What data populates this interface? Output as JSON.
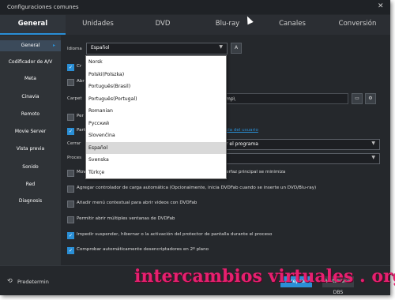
{
  "window": {
    "title": "Configuraciones comunes",
    "close": "✕"
  },
  "tabs": [
    "General",
    "Unidades",
    "DVD",
    "Blu-ray",
    "Canales",
    "Conversión"
  ],
  "sidebar": {
    "items": [
      "General",
      "Codificador de A/V",
      "Meta",
      "Cinavia",
      "Remoto",
      "Movie Server",
      "Vista previa",
      "Sonido",
      "Red",
      "Diagnosis"
    ],
    "active_arrow": "▸"
  },
  "language": {
    "label": "Idioma",
    "selected": "Español",
    "arrow": "▼",
    "font_button": "A",
    "options": [
      "Norsk",
      "Polski(Polszka)",
      "Português(Brasil)",
      "Português(Portugal)",
      "Romanian",
      "Русский",
      "Slovenčina",
      "Español",
      "Svenska",
      "Türkçe"
    ],
    "selected_index": 7
  },
  "partials": {
    "cr": "Cr",
    "abr": "Abr",
    "carpeta": "Carpet",
    "path_tail": "mp\\",
    "per": "Per",
    "part": "Part",
    "cerrar": "Cerrar",
    "procesar": "Proces",
    "mov": "Mov"
  },
  "right_texts": {
    "user_link": "cia del usuario",
    "close_program": "r el programa",
    "minimize": "erfaz principal se minimiza"
  },
  "checkboxes": [
    {
      "label": "Agregar controlador de carga automática (Opcionalmente, inicia DVDFab cuando se inserte un DVD/Blu-ray)",
      "checked": false
    },
    {
      "label": "Añadir menú contextual para abrir videos con DVDFab",
      "checked": false
    },
    {
      "label": "Permitir abrir múltiples ventanas de DVDFab",
      "checked": false
    },
    {
      "label": "Impedir suspender, hibernar o la activación del protector de pantalla durante el proceso",
      "checked": true
    },
    {
      "label": "Comprobar automáticamente desencriptadores en 2º plano",
      "checked": true
    }
  ],
  "footer": {
    "restore": "Predetermin",
    "restore_icon": "⟲",
    "apply": "Aceptar",
    "cancel": "Restablecer DBS"
  },
  "colors": {
    "accent": "#2a8fd6",
    "background": "#25282c",
    "watermark": "#e6206f"
  },
  "watermark": "intercambios virtuales . org"
}
